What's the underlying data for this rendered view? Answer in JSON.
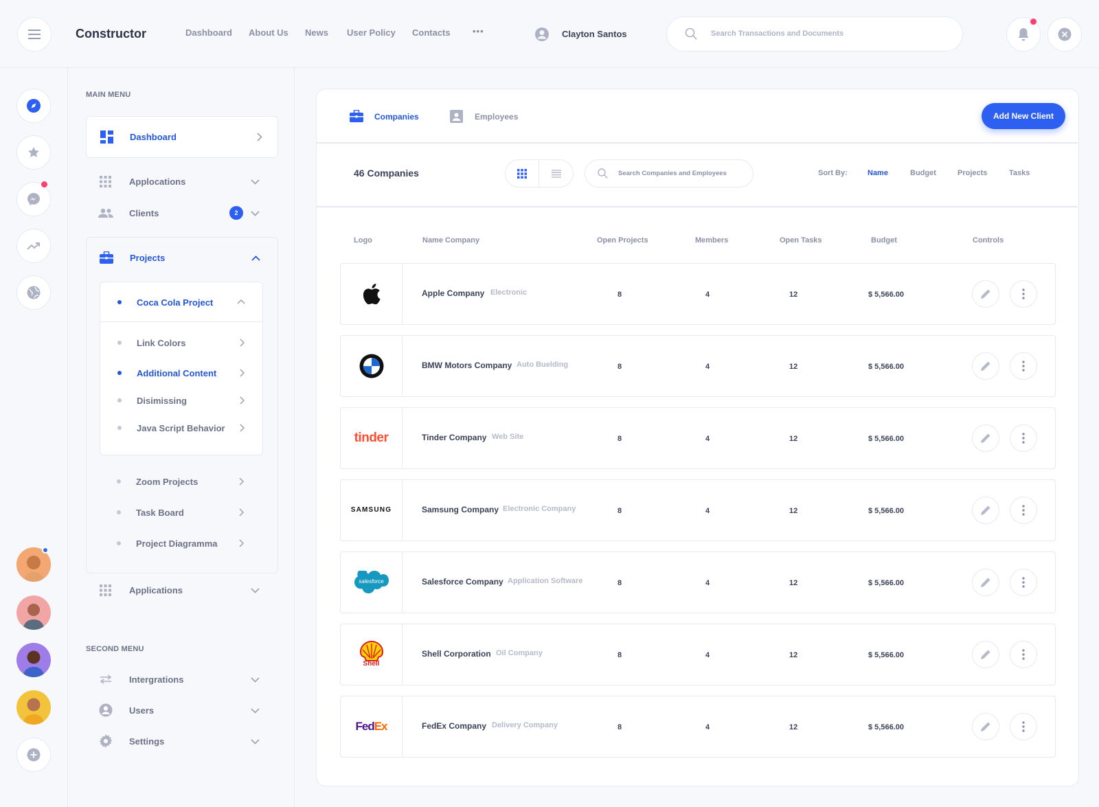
{
  "header": {
    "brand": "Constructor",
    "nav": [
      "Dashboard",
      "About Us",
      "News",
      "User Policy",
      "Contacts"
    ],
    "more": "•••",
    "user_name": "Clayton Santos",
    "search_placeholder": "Search Transactions and Documents"
  },
  "sidebar": {
    "main_menu_title": "MAIN MENU",
    "dashboard": "Dashboard",
    "applocations": "Applocations",
    "clients": "Clients",
    "clients_badge": "2",
    "projects": "Projects",
    "coca_cola": "Coca Cola Project",
    "coca_items": [
      "Link Colors",
      "Additional Content",
      "Disimissing",
      "Java Script Behavior"
    ],
    "project_items": [
      "Zoom Projects",
      "Task Board",
      "Project Diagramma"
    ],
    "applications": "Applications",
    "second_menu_title": "SECOND MENU",
    "intergrations": "Intergrations",
    "users": "Users",
    "settings": "Settings"
  },
  "main": {
    "tabs": [
      "Companies",
      "Employees"
    ],
    "add_button": "Add New Client",
    "count": "46 Companies",
    "search_placeholder": "Search Companies and Employees",
    "sort_label": "Sort By:",
    "sort_options": [
      "Name",
      "Budget",
      "Projects",
      "Tasks"
    ],
    "columns": [
      "Logo",
      "Name Company",
      "Open Projects",
      "Members",
      "Open Tasks",
      "Budget",
      "Controls"
    ],
    "rows": [
      {
        "name": "Apple Company",
        "category": "Electronic",
        "logo": "apple",
        "projects": "8",
        "members": "4",
        "tasks": "12",
        "budget": "$ 5,566.00"
      },
      {
        "name": "BMW Motors Company",
        "category": "Auto Buelding",
        "logo": "bmw",
        "projects": "8",
        "members": "4",
        "tasks": "12",
        "budget": "$ 5,566.00"
      },
      {
        "name": "Tinder Company",
        "category": "Web Site",
        "logo": "tinder",
        "logo_text": "tinder",
        "projects": "8",
        "members": "4",
        "tasks": "12",
        "budget": "$ 5,566.00"
      },
      {
        "name": "Samsung Company",
        "category": "Electronic Company",
        "logo": "samsung",
        "logo_text": "SAMSUNG",
        "projects": "8",
        "members": "4",
        "tasks": "12",
        "budget": "$ 5,566.00"
      },
      {
        "name": "Salesforce Company",
        "category": "Application Software",
        "logo": "salesforce",
        "logo_text": "salesforce",
        "projects": "8",
        "members": "4",
        "tasks": "12",
        "budget": "$ 5,566.00"
      },
      {
        "name": "Shell Corporation",
        "category": "Oil Company",
        "logo": "shell",
        "logo_text": "Shell",
        "projects": "8",
        "members": "4",
        "tasks": "12",
        "budget": "$ 5,566.00"
      },
      {
        "name": "FedEx Company",
        "category": "Delivery Company",
        "logo": "fedex",
        "logo_text": "FedEx",
        "projects": "8",
        "members": "4",
        "tasks": "12",
        "budget": "$ 5,566.00"
      }
    ]
  },
  "colors": {
    "accent": "#2d5ff0",
    "active_text": "#2356d9",
    "alert": "#ff3d6e"
  }
}
